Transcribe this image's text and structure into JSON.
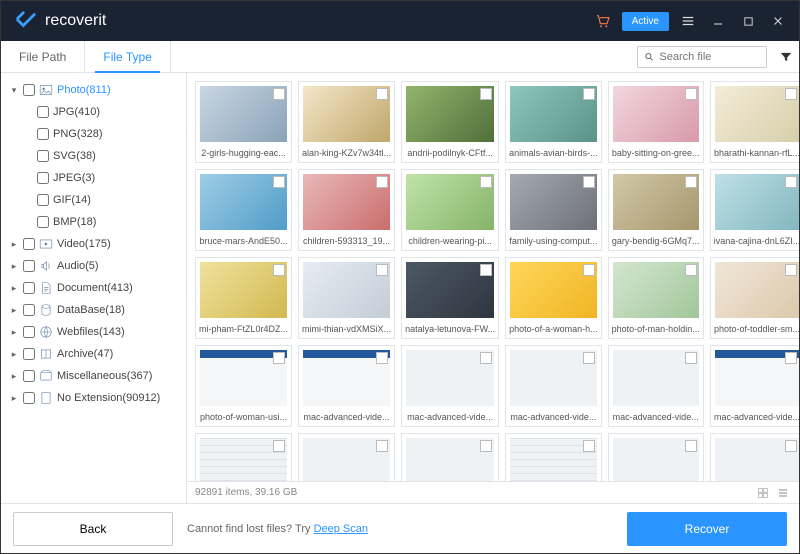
{
  "titlebar": {
    "brand": "recoverit",
    "active_label": "Active"
  },
  "toolbar": {
    "tabs": {
      "file_path": "File Path",
      "file_type": "File Type"
    },
    "search_placeholder": "Search file"
  },
  "sidebar": {
    "nodes": [
      {
        "label": "Photo(811)",
        "children": [
          {
            "label": "JPG(410)"
          },
          {
            "label": "PNG(328)"
          },
          {
            "label": "SVG(38)"
          },
          {
            "label": "JPEG(3)"
          },
          {
            "label": "GIF(14)"
          },
          {
            "label": "BMP(18)"
          }
        ]
      },
      {
        "label": "Video(175)"
      },
      {
        "label": "Audio(5)"
      },
      {
        "label": "Document(413)"
      },
      {
        "label": "DataBase(18)"
      },
      {
        "label": "Webfiles(143)"
      },
      {
        "label": "Archive(47)"
      },
      {
        "label": "Miscellaneous(367)"
      },
      {
        "label": "No Extension(90912)"
      }
    ]
  },
  "grid": {
    "files": [
      {
        "name": "2-girls-hugging-eac...",
        "art": "t1"
      },
      {
        "name": "alan-king-KZv7w34tl...",
        "art": "t2"
      },
      {
        "name": "andrii-podilnyk-CFtf...",
        "art": "t3"
      },
      {
        "name": "animals-avian-birds-...",
        "art": "t4"
      },
      {
        "name": "baby-sitting-on-gree...",
        "art": "t5"
      },
      {
        "name": "bharathi-kannan-rfL...",
        "art": "t6"
      },
      {
        "name": "bruce-mars-AndE50...",
        "art": "t7"
      },
      {
        "name": "children-593313_19...",
        "art": "t8"
      },
      {
        "name": "children-wearing-pi...",
        "art": "t9"
      },
      {
        "name": "family-using-comput...",
        "art": "t10"
      },
      {
        "name": "gary-bendig-6GMq7...",
        "art": "t11"
      },
      {
        "name": "ivana-cajina-dnL6ZI...",
        "art": "t12"
      },
      {
        "name": "mi-pham-FtZL0r4DZ...",
        "art": "t13"
      },
      {
        "name": "mimi-thian-vdXMSiX...",
        "art": "t14"
      },
      {
        "name": "natalya-letunova-FW...",
        "art": "t15"
      },
      {
        "name": "photo-of-a-woman-h...",
        "art": "t16"
      },
      {
        "name": "photo-of-man-holdin...",
        "art": "t17"
      },
      {
        "name": "photo-of-toddler-sm...",
        "art": "t18"
      },
      {
        "name": "photo-of-woman-usi...",
        "art": "tui"
      },
      {
        "name": "mac-advanced-vide...",
        "art": "tui"
      },
      {
        "name": "mac-advanced-vide...",
        "art": "tui2"
      },
      {
        "name": "mac-advanced-vide...",
        "art": "tui2"
      },
      {
        "name": "mac-advanced-vide...",
        "art": "tui2"
      },
      {
        "name": "mac-advanced-vide...",
        "art": "tui"
      },
      {
        "name": "",
        "art": "tui3"
      },
      {
        "name": "",
        "art": "tui2"
      },
      {
        "name": "",
        "art": "tui2"
      },
      {
        "name": "",
        "art": "tui3"
      },
      {
        "name": "",
        "art": "tui2"
      },
      {
        "name": "",
        "art": "tui2"
      }
    ]
  },
  "statusbar": {
    "summary": "92891 items, 39.16  GB"
  },
  "footer": {
    "back": "Back",
    "hint_prefix": "Cannot find lost files? Try ",
    "hint_link": "Deep Scan",
    "recover": "Recover"
  }
}
